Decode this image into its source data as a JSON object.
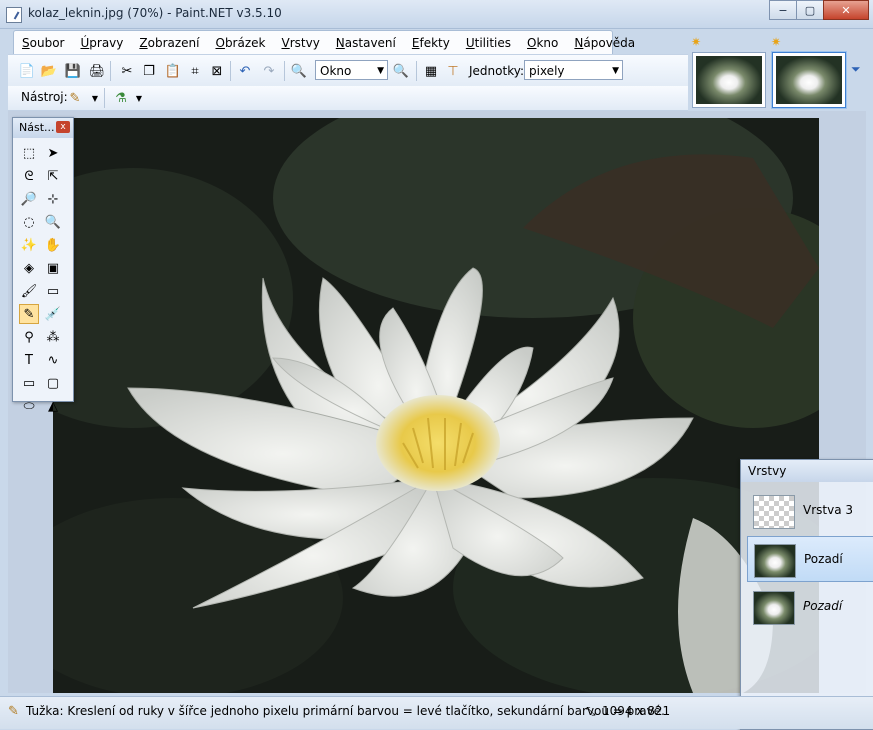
{
  "window": {
    "title": "kolaz_leknin.jpg (70%) - Paint.NET v3.5.10",
    "minimize_icon": "−",
    "maximize_icon": "▢",
    "close_icon": "✕"
  },
  "menu": [
    {
      "pre": "",
      "u": "S",
      "post": "oubor"
    },
    {
      "pre": "",
      "u": "Ú",
      "post": "pravy"
    },
    {
      "pre": "",
      "u": "Z",
      "post": "obrazení"
    },
    {
      "pre": "",
      "u": "O",
      "post": "brázek"
    },
    {
      "pre": "",
      "u": "V",
      "post": "rstvy"
    },
    {
      "pre": "",
      "u": "N",
      "post": "astavení"
    },
    {
      "pre": "",
      "u": "E",
      "post": "fekty"
    },
    {
      "pre": "",
      "u": "U",
      "post": "tilities"
    },
    {
      "pre": "",
      "u": "O",
      "post": "kno"
    },
    {
      "pre": "",
      "u": "N",
      "post": "ápověda"
    }
  ],
  "toolbar": {
    "zoom_value": "Okno",
    "units_label": "Jednotky:",
    "units_value": "pixely",
    "tool_label": "Nástroj:"
  },
  "tools_window": {
    "title": "Nást...",
    "close": "x",
    "tools": [
      "rect-select",
      "move-selection",
      "lasso-select",
      "move-selected",
      "zoom",
      "magic-wand-alt",
      "ellipse-select",
      "zoom-alt",
      "magic-wand",
      "pan",
      "paint-bucket",
      "gradient",
      "paintbrush",
      "eraser",
      "pencil",
      "color-picker",
      "clone-stamp",
      "recolor",
      "text",
      "line-curve",
      "rectangle",
      "rounded-rectangle",
      "ellipse",
      "freeform-shape"
    ],
    "selected_index": 14
  },
  "layers_window": {
    "title": "Vrstvy",
    "layers": [
      {
        "name": "Vrstva 3",
        "italic": false,
        "selected": false
      },
      {
        "name": "Pozadí",
        "italic": false,
        "selected": true
      },
      {
        "name": "Pozadí",
        "italic": true,
        "selected": false
      }
    ]
  },
  "status": {
    "text": "Tužka: Kreslení od ruky v šířce jednoho pixelu primární barvou = levé tlačítko, sekundární barvou = pravé.",
    "image_size": "1094 x 821"
  },
  "colors": {
    "accent": "#c5442d",
    "selection": "#ffe3a0"
  }
}
